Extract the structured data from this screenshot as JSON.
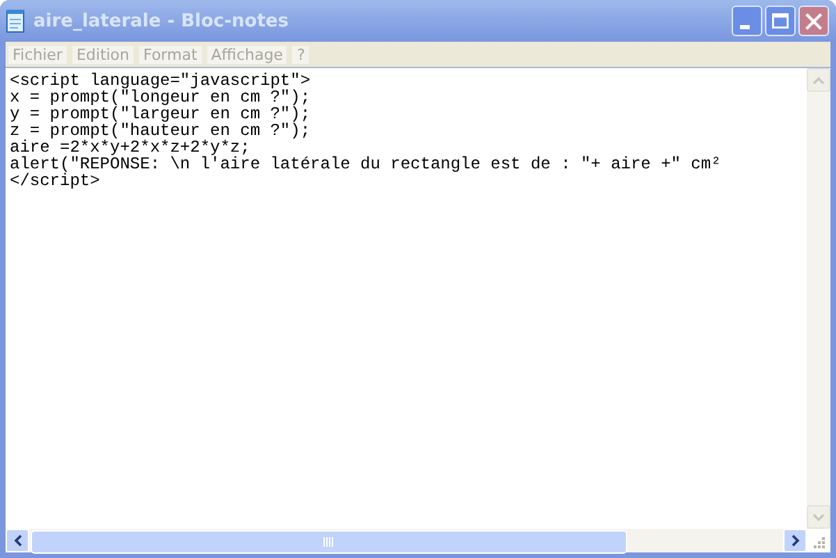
{
  "window": {
    "title": "aire_laterale - Bloc-notes"
  },
  "menu": [
    "Fichier",
    "Edition",
    "Format",
    "Affichage",
    "?"
  ],
  "editor": {
    "lines": [
      "<script language=\"javascript\">",
      "x = prompt(\"longeur en cm ?\");",
      "y = prompt(\"largeur en cm ?\");",
      "z = prompt(\"hauteur en cm ?\");",
      "aire =2*x*y+2*x*z+2*y*z;",
      "alert(\"REPONSE: \\n l'aire latérale du rectangle est de : \"+ aire +\" cm²",
      "</script>"
    ]
  }
}
